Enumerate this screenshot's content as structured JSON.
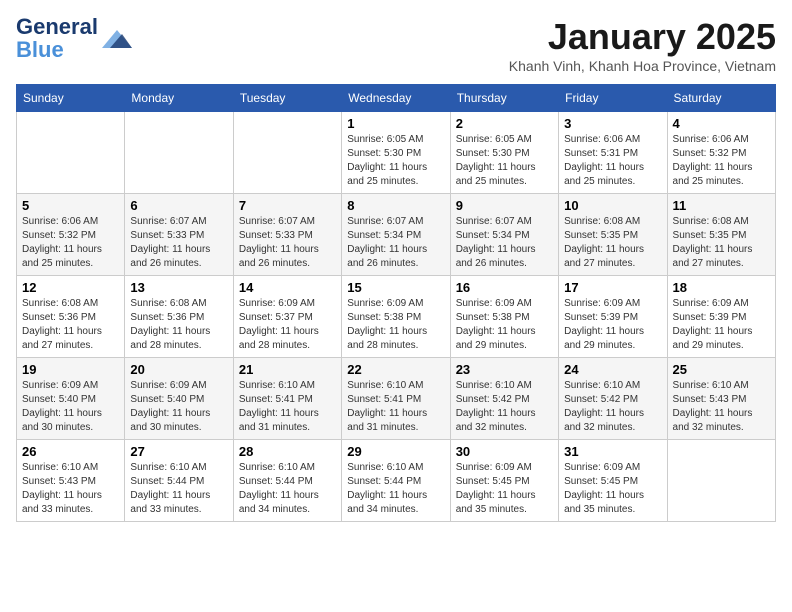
{
  "logo": {
    "general": "General",
    "blue": "Blue",
    "icon_color": "#4a90d9"
  },
  "title": "January 2025",
  "subtitle": "Khanh Vinh, Khanh Hoa Province, Vietnam",
  "days_of_week": [
    "Sunday",
    "Monday",
    "Tuesday",
    "Wednesday",
    "Thursday",
    "Friday",
    "Saturday"
  ],
  "weeks": [
    {
      "days": [
        {
          "num": "",
          "info": ""
        },
        {
          "num": "",
          "info": ""
        },
        {
          "num": "",
          "info": ""
        },
        {
          "num": "1",
          "info": "Sunrise: 6:05 AM\nSunset: 5:30 PM\nDaylight: 11 hours\nand 25 minutes."
        },
        {
          "num": "2",
          "info": "Sunrise: 6:05 AM\nSunset: 5:30 PM\nDaylight: 11 hours\nand 25 minutes."
        },
        {
          "num": "3",
          "info": "Sunrise: 6:06 AM\nSunset: 5:31 PM\nDaylight: 11 hours\nand 25 minutes."
        },
        {
          "num": "4",
          "info": "Sunrise: 6:06 AM\nSunset: 5:32 PM\nDaylight: 11 hours\nand 25 minutes."
        }
      ],
      "shaded": false
    },
    {
      "days": [
        {
          "num": "5",
          "info": "Sunrise: 6:06 AM\nSunset: 5:32 PM\nDaylight: 11 hours\nand 25 minutes."
        },
        {
          "num": "6",
          "info": "Sunrise: 6:07 AM\nSunset: 5:33 PM\nDaylight: 11 hours\nand 26 minutes."
        },
        {
          "num": "7",
          "info": "Sunrise: 6:07 AM\nSunset: 5:33 PM\nDaylight: 11 hours\nand 26 minutes."
        },
        {
          "num": "8",
          "info": "Sunrise: 6:07 AM\nSunset: 5:34 PM\nDaylight: 11 hours\nand 26 minutes."
        },
        {
          "num": "9",
          "info": "Sunrise: 6:07 AM\nSunset: 5:34 PM\nDaylight: 11 hours\nand 26 minutes."
        },
        {
          "num": "10",
          "info": "Sunrise: 6:08 AM\nSunset: 5:35 PM\nDaylight: 11 hours\nand 27 minutes."
        },
        {
          "num": "11",
          "info": "Sunrise: 6:08 AM\nSunset: 5:35 PM\nDaylight: 11 hours\nand 27 minutes."
        }
      ],
      "shaded": true
    },
    {
      "days": [
        {
          "num": "12",
          "info": "Sunrise: 6:08 AM\nSunset: 5:36 PM\nDaylight: 11 hours\nand 27 minutes."
        },
        {
          "num": "13",
          "info": "Sunrise: 6:08 AM\nSunset: 5:36 PM\nDaylight: 11 hours\nand 28 minutes."
        },
        {
          "num": "14",
          "info": "Sunrise: 6:09 AM\nSunset: 5:37 PM\nDaylight: 11 hours\nand 28 minutes."
        },
        {
          "num": "15",
          "info": "Sunrise: 6:09 AM\nSunset: 5:38 PM\nDaylight: 11 hours\nand 28 minutes."
        },
        {
          "num": "16",
          "info": "Sunrise: 6:09 AM\nSunset: 5:38 PM\nDaylight: 11 hours\nand 29 minutes."
        },
        {
          "num": "17",
          "info": "Sunrise: 6:09 AM\nSunset: 5:39 PM\nDaylight: 11 hours\nand 29 minutes."
        },
        {
          "num": "18",
          "info": "Sunrise: 6:09 AM\nSunset: 5:39 PM\nDaylight: 11 hours\nand 29 minutes."
        }
      ],
      "shaded": false
    },
    {
      "days": [
        {
          "num": "19",
          "info": "Sunrise: 6:09 AM\nSunset: 5:40 PM\nDaylight: 11 hours\nand 30 minutes."
        },
        {
          "num": "20",
          "info": "Sunrise: 6:09 AM\nSunset: 5:40 PM\nDaylight: 11 hours\nand 30 minutes."
        },
        {
          "num": "21",
          "info": "Sunrise: 6:10 AM\nSunset: 5:41 PM\nDaylight: 11 hours\nand 31 minutes."
        },
        {
          "num": "22",
          "info": "Sunrise: 6:10 AM\nSunset: 5:41 PM\nDaylight: 11 hours\nand 31 minutes."
        },
        {
          "num": "23",
          "info": "Sunrise: 6:10 AM\nSunset: 5:42 PM\nDaylight: 11 hours\nand 32 minutes."
        },
        {
          "num": "24",
          "info": "Sunrise: 6:10 AM\nSunset: 5:42 PM\nDaylight: 11 hours\nand 32 minutes."
        },
        {
          "num": "25",
          "info": "Sunrise: 6:10 AM\nSunset: 5:43 PM\nDaylight: 11 hours\nand 32 minutes."
        }
      ],
      "shaded": true
    },
    {
      "days": [
        {
          "num": "26",
          "info": "Sunrise: 6:10 AM\nSunset: 5:43 PM\nDaylight: 11 hours\nand 33 minutes."
        },
        {
          "num": "27",
          "info": "Sunrise: 6:10 AM\nSunset: 5:44 PM\nDaylight: 11 hours\nand 33 minutes."
        },
        {
          "num": "28",
          "info": "Sunrise: 6:10 AM\nSunset: 5:44 PM\nDaylight: 11 hours\nand 34 minutes."
        },
        {
          "num": "29",
          "info": "Sunrise: 6:10 AM\nSunset: 5:44 PM\nDaylight: 11 hours\nand 34 minutes."
        },
        {
          "num": "30",
          "info": "Sunrise: 6:09 AM\nSunset: 5:45 PM\nDaylight: 11 hours\nand 35 minutes."
        },
        {
          "num": "31",
          "info": "Sunrise: 6:09 AM\nSunset: 5:45 PM\nDaylight: 11 hours\nand 35 minutes."
        },
        {
          "num": "",
          "info": ""
        }
      ],
      "shaded": false
    }
  ]
}
